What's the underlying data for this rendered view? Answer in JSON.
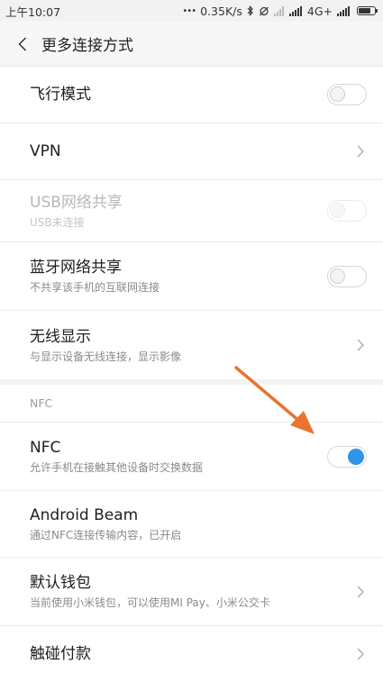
{
  "status_bar": {
    "time": "上午10:07",
    "dots": "•••",
    "speed": "0.35K/s",
    "network": "4G+",
    "bluetooth_icon": "bluetooth-icon",
    "alarm_icon": "alarm-off-icon",
    "signal_icon": "signal-icon",
    "battery_icon": "battery-icon"
  },
  "header": {
    "back_icon": "back-chevron-icon",
    "title": "更多连接方式"
  },
  "rows": [
    {
      "label": "飞行模式",
      "sub": "",
      "control": "switch",
      "state": "off"
    },
    {
      "label": "VPN",
      "sub": "",
      "control": "chevron"
    },
    {
      "label": "USB网络共享",
      "sub": "USB未连接",
      "control": "switch",
      "state": "disabled"
    },
    {
      "label": "蓝牙网络共享",
      "sub": "不共享该手机的互联网连接",
      "control": "switch",
      "state": "off"
    },
    {
      "label": "无线显示",
      "sub": "与显示设备无线连接，显示影像",
      "control": "chevron"
    }
  ],
  "nfc_section": {
    "header": "NFC",
    "rows": [
      {
        "label": "NFC",
        "sub": "允许手机在接触其他设备时交换数据",
        "control": "switch",
        "state": "on"
      },
      {
        "label": "Android Beam",
        "sub": "通过NFC连接传输内容，已开启",
        "control": "none"
      },
      {
        "label": "默认钱包",
        "sub": "当前使用小米钱包，可以使用MI Pay、小米公交卡",
        "control": "chevron"
      },
      {
        "label": "触碰付款",
        "sub": "",
        "control": "chevron"
      }
    ]
  },
  "colors": {
    "accent": "#2f95e8",
    "annotation_arrow": "#e8742e"
  }
}
